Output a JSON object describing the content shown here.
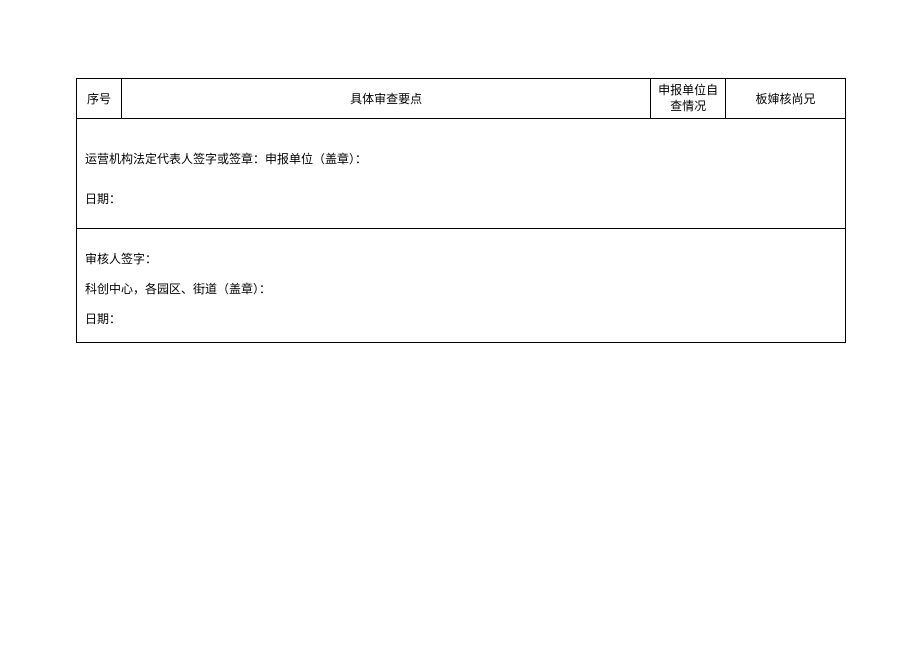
{
  "header": {
    "col_seq": "序号",
    "col_main": "具体审查要点",
    "col_selfcheck": "申报单位自查情况",
    "col_review": "板婶核尚兄"
  },
  "section1": {
    "line1": "运营机构法定代表人签字或签章：申报单位（盖章）：",
    "line2": "日期："
  },
  "section2": {
    "line1": "审核人签字：",
    "line2": "科创中心，各园区、街道（盖章）：",
    "line3": "日期："
  }
}
